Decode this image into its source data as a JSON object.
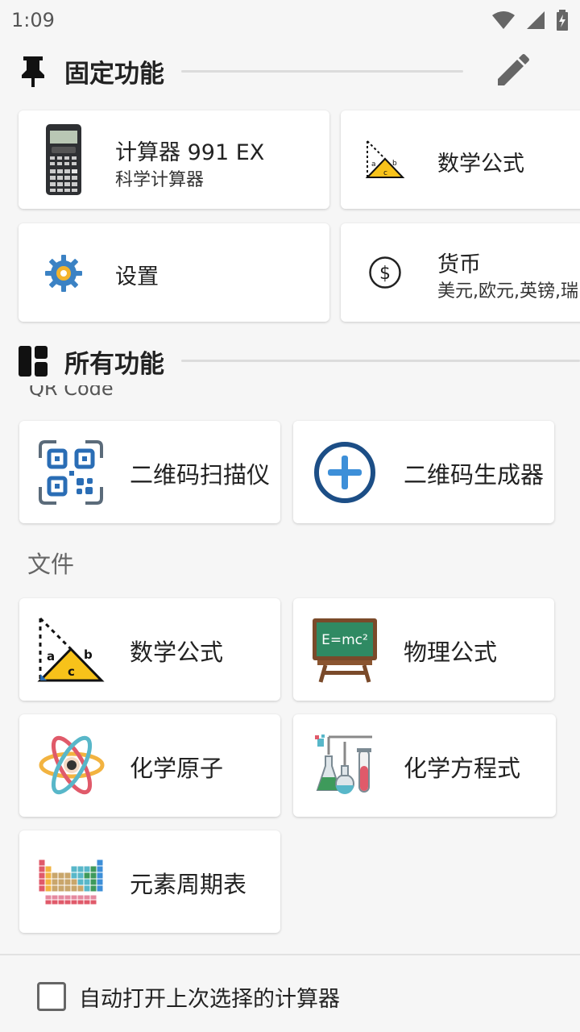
{
  "status_bar": {
    "time": "1:09",
    "icons": [
      "wifi-icon",
      "signal-icon",
      "battery-charging-icon"
    ]
  },
  "pinned": {
    "title": "固定功能",
    "items": [
      {
        "title": "计算器 991 EX",
        "subtitle": "科学计算器",
        "icon": "calculator-icon"
      },
      {
        "title": "数学公式",
        "icon": "triangle-formula-icon"
      },
      {
        "title": "设置",
        "icon": "gear-icon"
      },
      {
        "title": "货币",
        "subtitle": "美元,欧元,英镑,瑞",
        "icon": "dollar-coin-icon"
      }
    ]
  },
  "all": {
    "title": "所有功能",
    "cut_label": "QR Code",
    "qr_items": [
      {
        "title": "二维码扫描仪",
        "icon": "qr-scan-icon"
      },
      {
        "title": "二维码生成器",
        "icon": "add-circle-icon"
      }
    ],
    "files_label": "文件",
    "file_items": [
      {
        "title": "数学公式",
        "icon": "triangle-formula-icon"
      },
      {
        "title": "物理公式",
        "icon": "blackboard-emc2-icon",
        "board_text": "E=mc²"
      },
      {
        "title": "化学原子",
        "icon": "atom-icon"
      },
      {
        "title": "化学方程式",
        "icon": "lab-flasks-icon"
      },
      {
        "title": "元素周期表",
        "icon": "periodic-table-icon"
      }
    ]
  },
  "bottom": {
    "auto_open_label": "自动打开上次选择的计算器"
  },
  "colors": {
    "accent": "#1f6bb0",
    "qr_blue": "#2a6db5",
    "triangle_yellow": "#f7c21a"
  }
}
